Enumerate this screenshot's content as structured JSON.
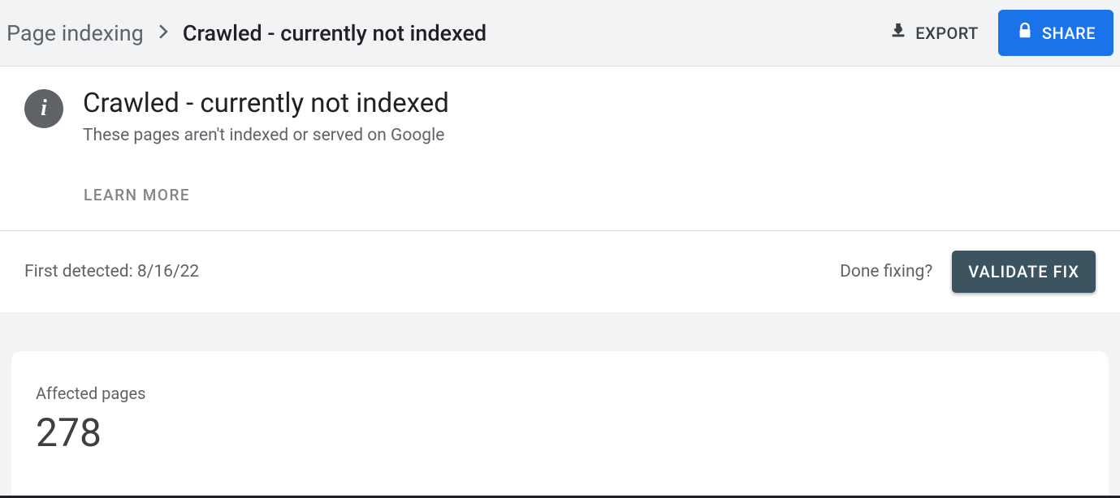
{
  "header": {
    "breadcrumb_parent": "Page indexing",
    "breadcrumb_current": "Crawled - currently not indexed",
    "export_label": "EXPORT",
    "share_label": "SHARE"
  },
  "info": {
    "title": "Crawled - currently not indexed",
    "subtitle": "These pages aren't indexed or served on Google",
    "learn_more": "LEARN MORE"
  },
  "validation": {
    "first_detected_label": "First detected: ",
    "first_detected_date": "8/16/22",
    "done_fixing_label": "Done fixing?",
    "validate_label": "VALIDATE FIX"
  },
  "affected": {
    "label": "Affected pages",
    "count": "278"
  }
}
